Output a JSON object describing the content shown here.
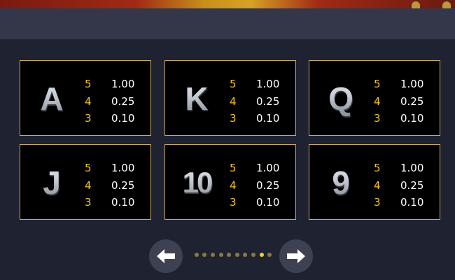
{
  "paytable": {
    "cards": [
      {
        "symbol": "A",
        "pays": [
          {
            "count": "5",
            "value": "1.00"
          },
          {
            "count": "4",
            "value": "0.25"
          },
          {
            "count": "3",
            "value": "0.10"
          }
        ]
      },
      {
        "symbol": "K",
        "pays": [
          {
            "count": "5",
            "value": "1.00"
          },
          {
            "count": "4",
            "value": "0.25"
          },
          {
            "count": "3",
            "value": "0.10"
          }
        ]
      },
      {
        "symbol": "Q",
        "pays": [
          {
            "count": "5",
            "value": "1.00"
          },
          {
            "count": "4",
            "value": "0.25"
          },
          {
            "count": "3",
            "value": "0.10"
          }
        ]
      },
      {
        "symbol": "J",
        "pays": [
          {
            "count": "5",
            "value": "1.00"
          },
          {
            "count": "4",
            "value": "0.25"
          },
          {
            "count": "3",
            "value": "0.10"
          }
        ]
      },
      {
        "symbol": "10",
        "pays": [
          {
            "count": "5",
            "value": "1.00"
          },
          {
            "count": "4",
            "value": "0.25"
          },
          {
            "count": "3",
            "value": "0.10"
          }
        ]
      },
      {
        "symbol": "9",
        "pays": [
          {
            "count": "5",
            "value": "1.00"
          },
          {
            "count": "4",
            "value": "0.25"
          },
          {
            "count": "3",
            "value": "0.10"
          }
        ]
      }
    ]
  },
  "pager": {
    "total_pages": 10,
    "current_page": 9,
    "prev_icon": "arrow-left-icon",
    "next_icon": "arrow-right-icon"
  },
  "colors": {
    "card_border": "#c9aa62",
    "count_color": "#f3c319",
    "value_color": "#ffffff",
    "dot_active": "#f6cf2e",
    "dot_inactive": "#8a7a3e",
    "background": "#1f2230",
    "header_bar": "#34374a"
  }
}
